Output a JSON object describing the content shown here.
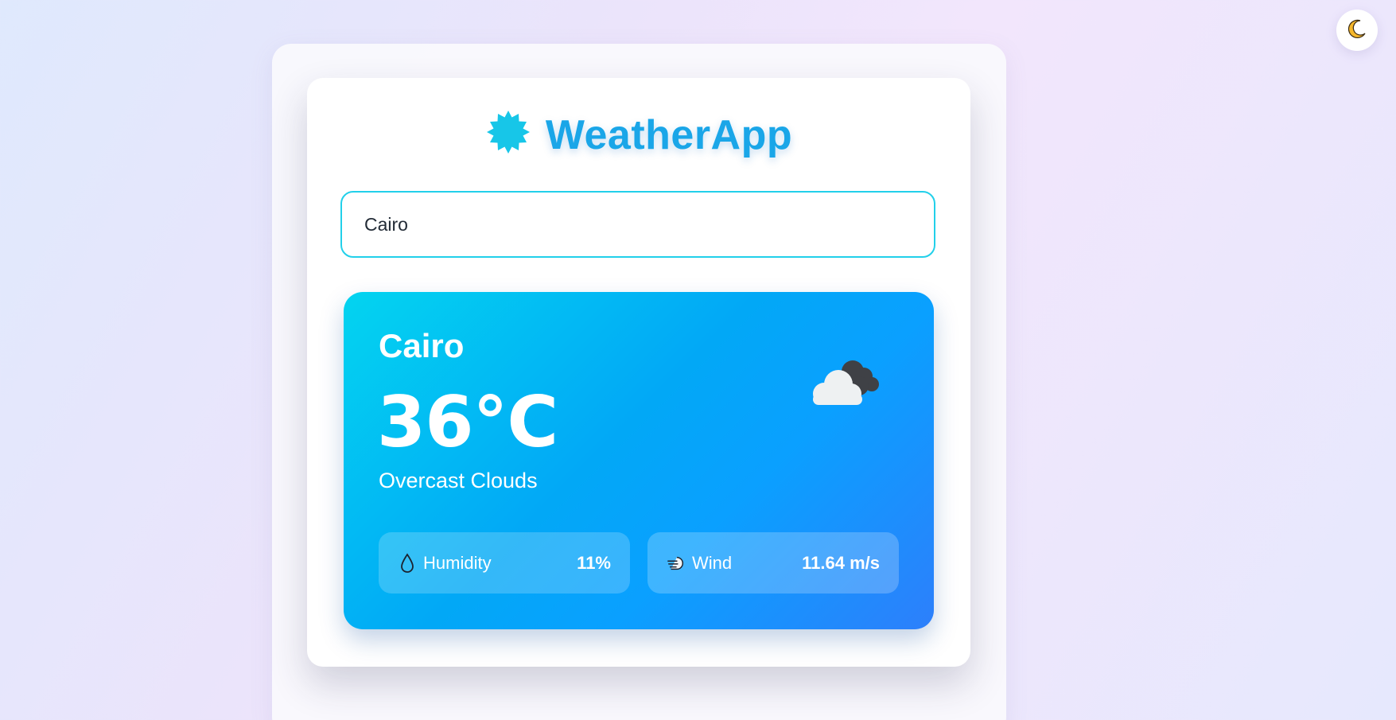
{
  "app": {
    "title": "WeatherApp",
    "logo_icon": "sun-badge-icon",
    "theme_toggle_icon": "moon-icon"
  },
  "search": {
    "value": "Cairo",
    "placeholder": ""
  },
  "weather": {
    "city": "Cairo",
    "temperature": "36°C",
    "description": "Overcast Clouds",
    "condition_icon": "overcast-clouds-icon",
    "humidity": {
      "label": "Humidity",
      "value": "11%",
      "icon": "droplet-icon"
    },
    "wind": {
      "label": "Wind",
      "value": "11.64 m/s",
      "icon": "wind-icon"
    }
  },
  "colors": {
    "accent": "#1aa6e8",
    "input_border": "#22d0ea",
    "card_gradient_start": "#03d4f0",
    "card_gradient_end": "#2d7ffb"
  }
}
